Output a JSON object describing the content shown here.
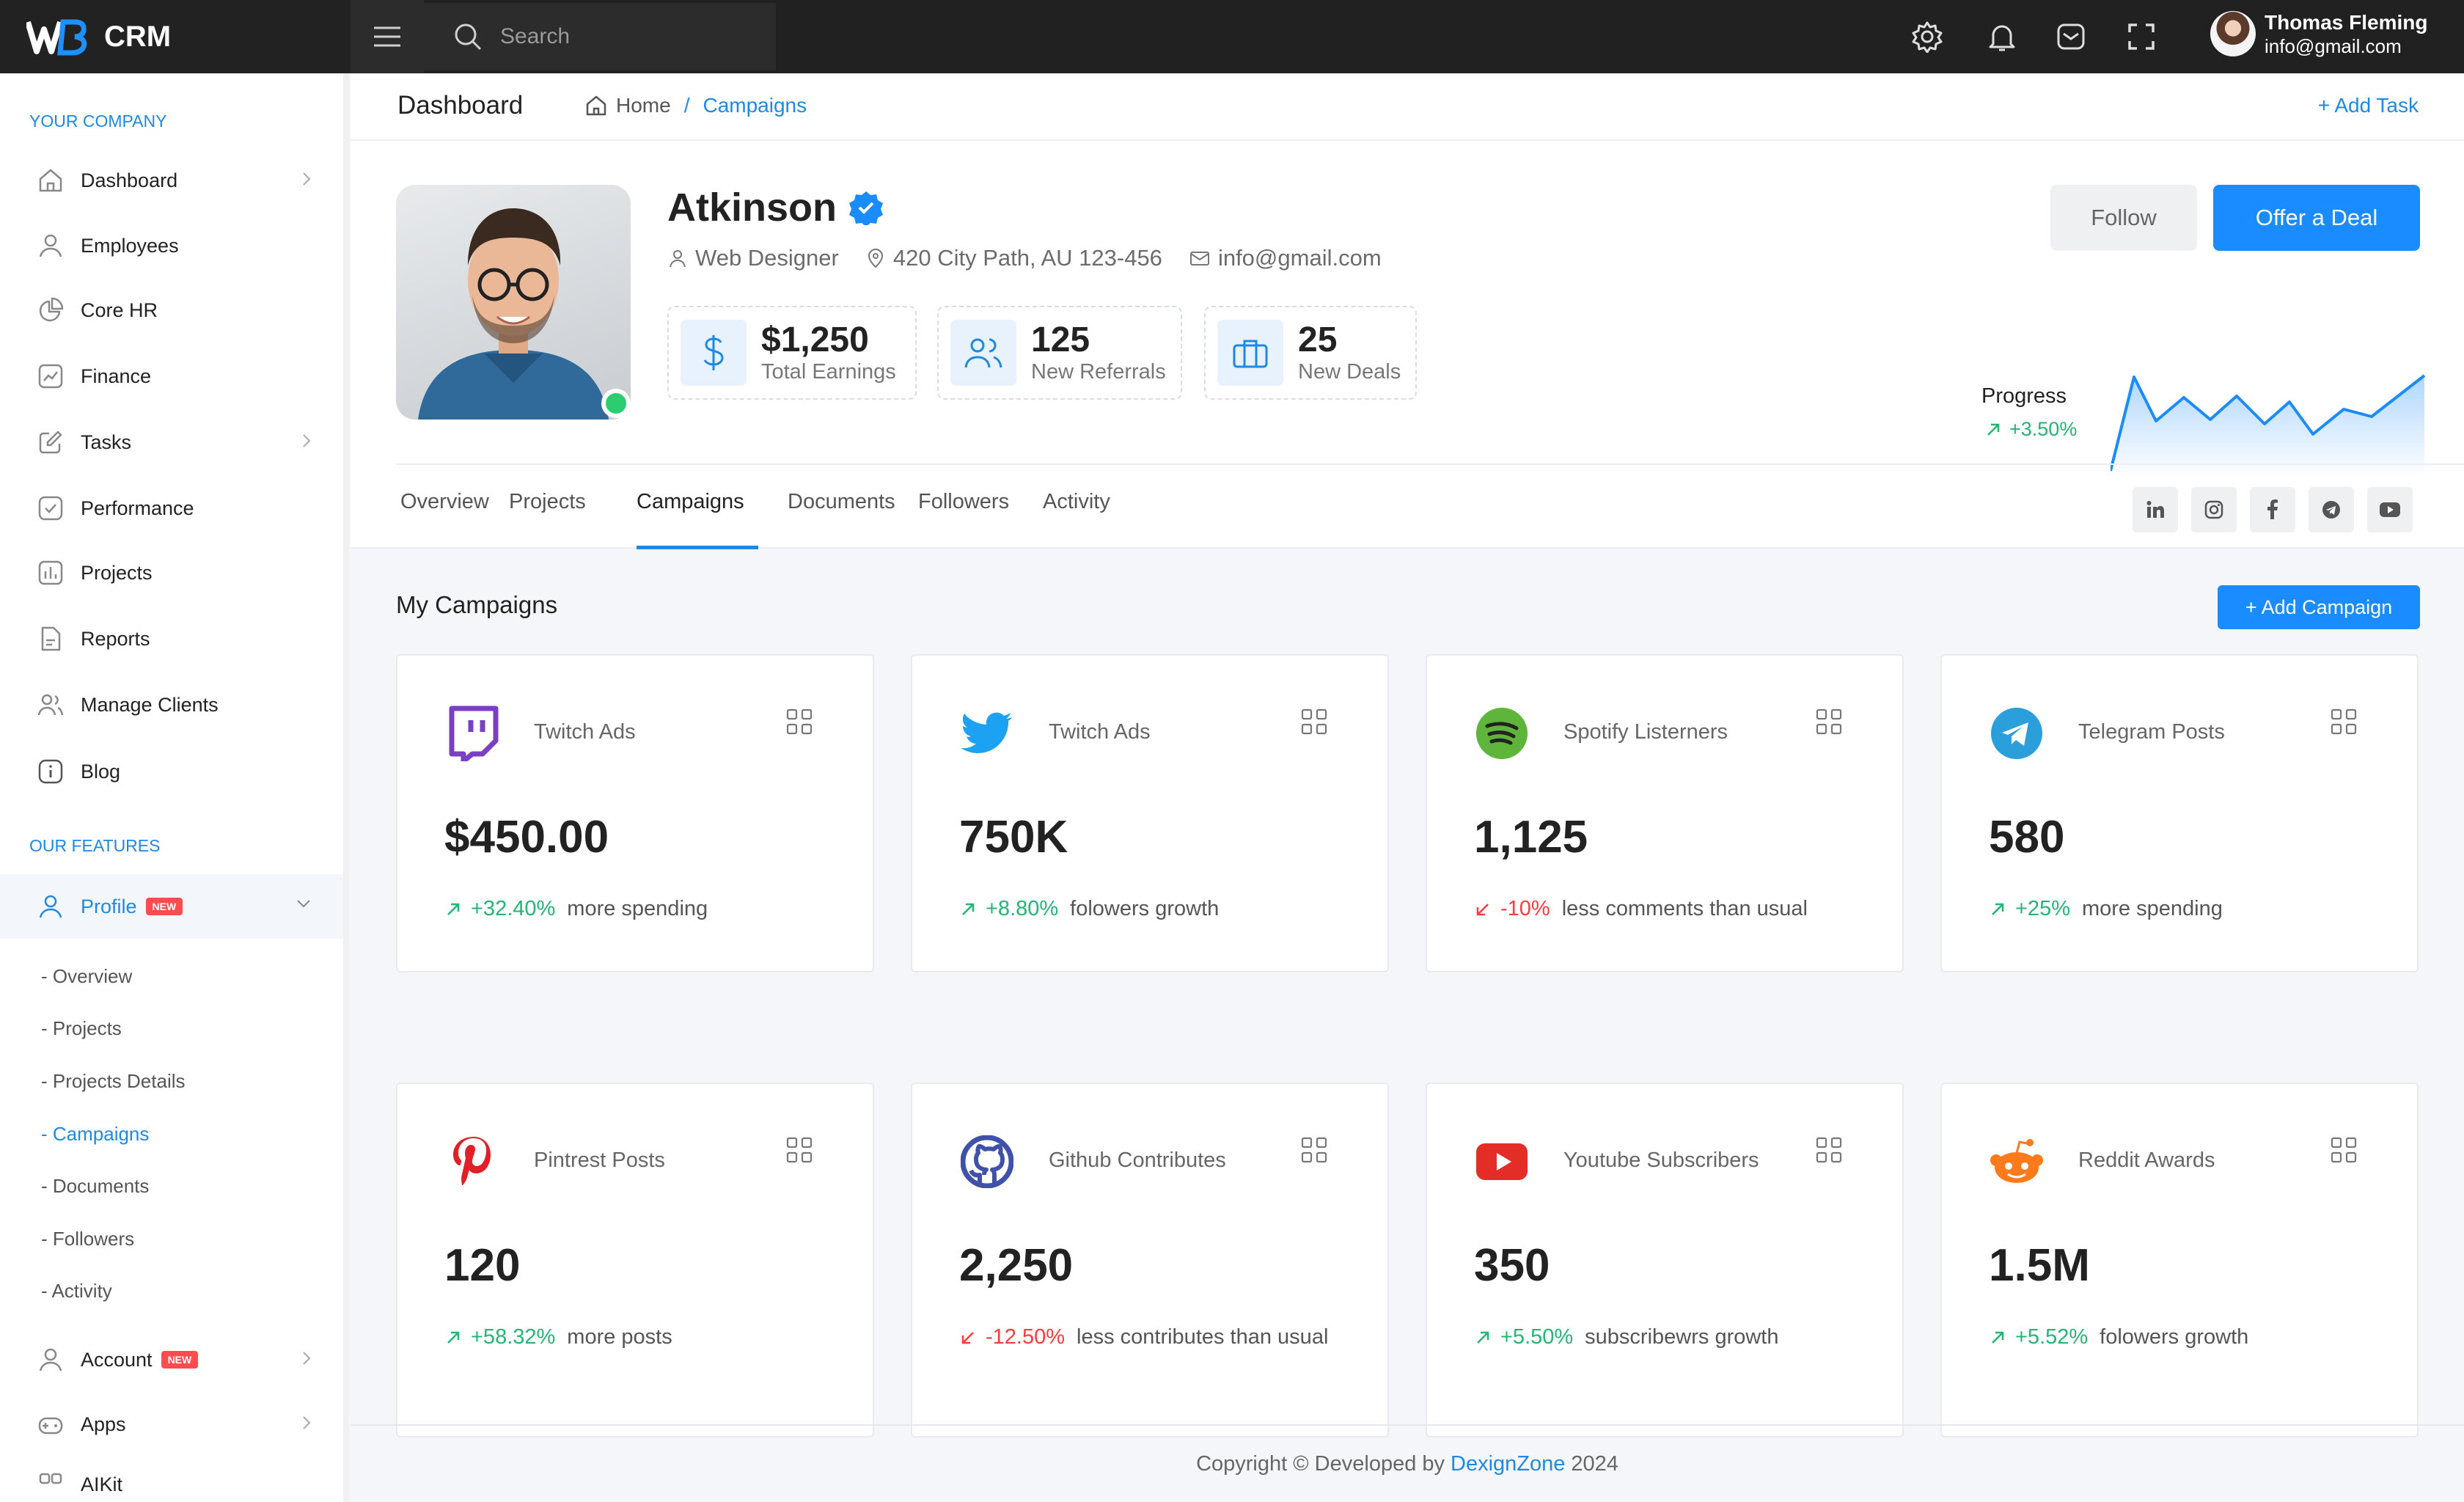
{
  "app": {
    "logo": "WB",
    "name": "CRM"
  },
  "topbar": {
    "search_placeholder": "Search",
    "user_name": "Thomas Fleming",
    "user_email": "info@gmail.com"
  },
  "sidebar": {
    "section1": "YOUR COMPANY",
    "items": [
      {
        "label": "Dashboard"
      },
      {
        "label": "Employees"
      },
      {
        "label": "Core HR"
      },
      {
        "label": "Finance"
      },
      {
        "label": "Tasks"
      },
      {
        "label": "Performance"
      },
      {
        "label": "Projects"
      },
      {
        "label": "Reports"
      },
      {
        "label": "Manage Clients"
      },
      {
        "label": "Blog"
      }
    ],
    "section2": "OUR FEATURES",
    "profile": {
      "label": "Profile",
      "badge": "NEW"
    },
    "subitems": [
      {
        "label": "- Overview"
      },
      {
        "label": "- Projects"
      },
      {
        "label": "- Projects Details"
      },
      {
        "label": "- Campaigns"
      },
      {
        "label": "- Documents"
      },
      {
        "label": "- Followers"
      },
      {
        "label": "- Activity"
      }
    ],
    "account": {
      "label": "Account",
      "badge": "NEW"
    },
    "apps": {
      "label": "Apps"
    },
    "aikit": {
      "label": "AIKit"
    }
  },
  "header": {
    "title": "Dashboard",
    "crumb_home": "Home",
    "crumb_sep": "/",
    "crumb_current": "Campaigns",
    "add_task": "+ Add Task"
  },
  "profile": {
    "name": "Atkinson",
    "role": "Web Designer",
    "location": "420 City Path, AU 123-456",
    "email": "info@gmail.com",
    "stats": [
      {
        "value": "$1,250",
        "label": "Total Earnings"
      },
      {
        "value": "125",
        "label": "New Referrals"
      },
      {
        "value": "25",
        "label": "New Deals"
      }
    ],
    "follow_label": "Follow",
    "offer_label": "Offer a Deal",
    "progress_label": "Progress",
    "progress_value": "+3.50%"
  },
  "tabs": [
    {
      "label": "Overview"
    },
    {
      "label": "Projects"
    },
    {
      "label": "Campaigns"
    },
    {
      "label": "Documents"
    },
    {
      "label": "Followers"
    },
    {
      "label": "Activity"
    }
  ],
  "campaigns": {
    "title": "My Campaigns",
    "add_label": "+ Add Campaign",
    "cards": [
      {
        "icon": "twitch-icon",
        "name": "Twitch Ads",
        "value": "$450.00",
        "pct": "+32.40%",
        "dir": "up",
        "text": "more spending"
      },
      {
        "icon": "twitter-icon",
        "name": "Twitch Ads",
        "value": "750K",
        "pct": "+8.80%",
        "dir": "up",
        "text": "folowers growth"
      },
      {
        "icon": "spotify-icon",
        "name": "Spotify Listerners",
        "value": "1,125",
        "pct": "-10%",
        "dir": "down",
        "text": "less comments than usual"
      },
      {
        "icon": "telegram-icon",
        "name": "Telegram Posts",
        "value": "580",
        "pct": "+25%",
        "dir": "up",
        "text": "more spending"
      },
      {
        "icon": "pinterest-icon",
        "name": "Pintrest Posts",
        "value": "120",
        "pct": "+58.32%",
        "dir": "up",
        "text": "more posts"
      },
      {
        "icon": "github-icon",
        "name": "Github Contributes",
        "value": "2,250",
        "pct": "-12.50%",
        "dir": "down",
        "text": "less contributes than usual"
      },
      {
        "icon": "youtube-icon",
        "name": "Youtube Subscribers",
        "value": "350",
        "pct": "+5.50%",
        "dir": "up",
        "text": "subscribewrs growth"
      },
      {
        "icon": "reddit-icon",
        "name": "Reddit Awards",
        "value": "1.5M",
        "pct": "+5.52%",
        "dir": "up",
        "text": "folowers growth"
      }
    ]
  },
  "footer": {
    "prefix": "Copyright © Developed by",
    "link": "DexignZone",
    "year": "2024"
  },
  "colors": {
    "accent": "#1a8cff",
    "positive": "#22b573",
    "negative": "#ff3b3b",
    "topbar": "#212121"
  }
}
